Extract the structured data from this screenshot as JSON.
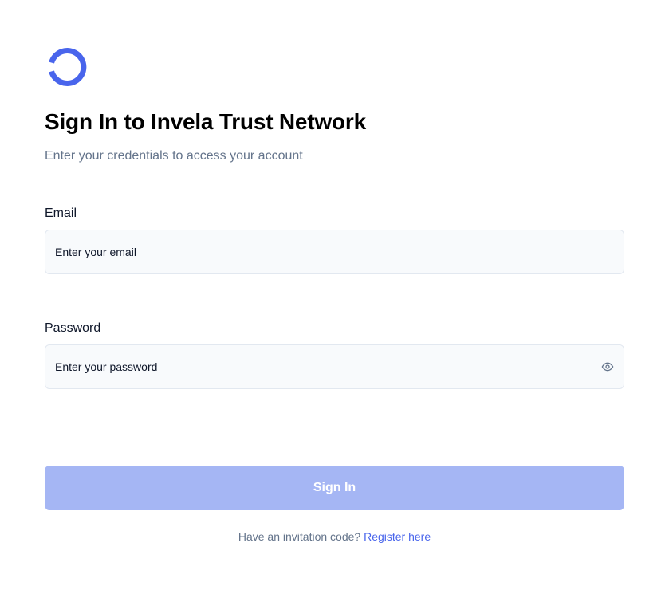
{
  "brand": {
    "logo_icon": "ring-logo-icon",
    "accent_color": "#4965ec"
  },
  "header": {
    "title": "Sign In to Invela Trust Network",
    "subtitle": "Enter your credentials to access your account"
  },
  "form": {
    "email": {
      "label": "Email",
      "placeholder": "Enter your email",
      "value": ""
    },
    "password": {
      "label": "Password",
      "placeholder": "Enter your password",
      "value": "",
      "toggle_icon": "eye-icon"
    },
    "submit_label": "Sign In",
    "submit_color": "#a5b6f4"
  },
  "footer": {
    "prompt": "Have an invitation code?",
    "link_label": "Register here"
  }
}
